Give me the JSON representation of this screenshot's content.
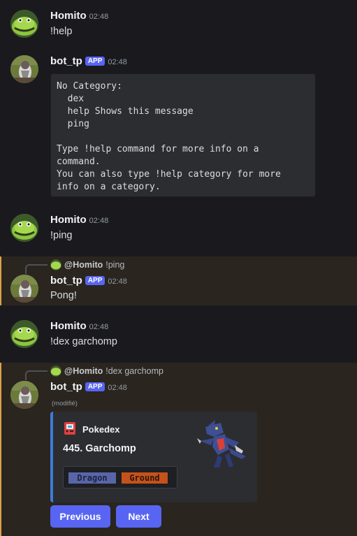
{
  "messages": [
    {
      "author": "Homito",
      "time": "02:48",
      "text": "!help"
    },
    {
      "author": "bot_tp",
      "badge": "APP",
      "time": "02:48",
      "code": "No Category:\n  dex\n  help Shows this message\n  ping\n\nType !help command for more info on a\ncommand.\nYou can also type !help category for more\ninfo on a category."
    },
    {
      "author": "Homito",
      "time": "02:48",
      "text": "!ping"
    },
    {
      "reply_to": "@Homito",
      "reply_text": "!ping",
      "author": "bot_tp",
      "badge": "APP",
      "time": "02:48",
      "text": "Pong!"
    },
    {
      "author": "Homito",
      "time": "02:48",
      "text": "!dex garchomp"
    },
    {
      "reply_to": "@Homito",
      "reply_text": "!dex garchomp",
      "author": "bot_tp",
      "badge": "APP",
      "time": "02:48",
      "edited": "(modifié)"
    }
  ],
  "embed": {
    "author": "Pokedex",
    "title": "445. Garchomp",
    "types": [
      "Dragon",
      "Ground"
    ],
    "accent": "#3e7bd8"
  },
  "buttons": {
    "previous": "Previous",
    "next": "Next"
  },
  "colors": {
    "background": "#1a1a1e",
    "highlight": "#2a251f",
    "highlight_border": "#d9a24a",
    "brand": "#5865f2"
  }
}
